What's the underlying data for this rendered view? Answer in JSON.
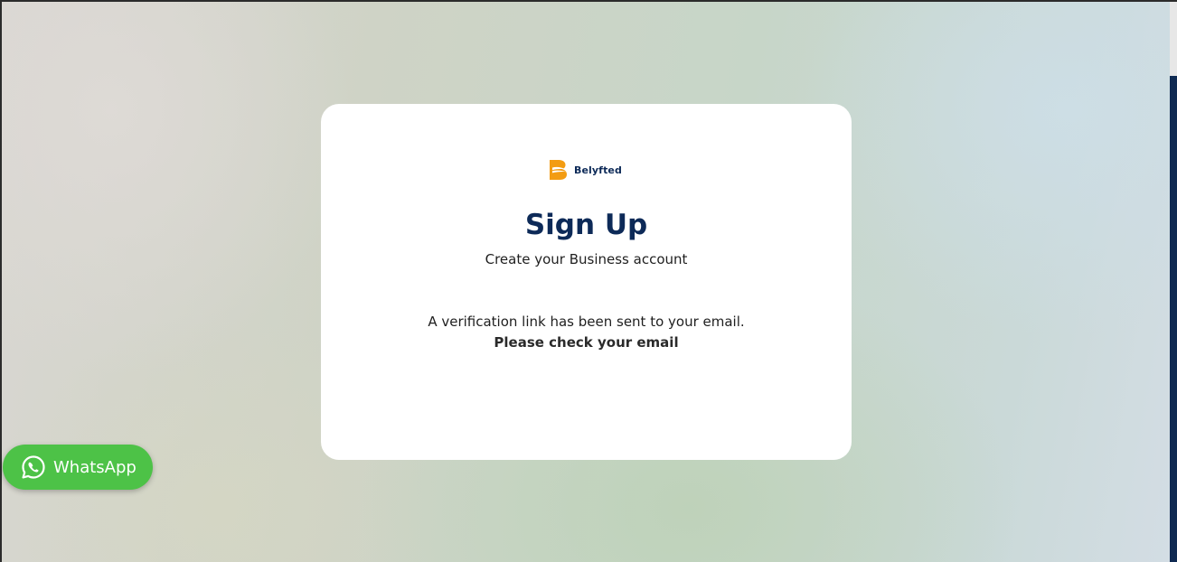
{
  "brand": {
    "name": "Belyfted",
    "logo_icon": "belyfted-b-icon",
    "primary_color": "#0d2a58",
    "accent_color": "#f39c12"
  },
  "signup": {
    "title": "Sign Up",
    "subtitle": "Create your Business account",
    "message": "A verification link has been sent to your email.",
    "message_bold": "Please check your email"
  },
  "whatsapp": {
    "label": "WhatsApp",
    "icon": "whatsapp-icon",
    "color": "#4dc247"
  }
}
